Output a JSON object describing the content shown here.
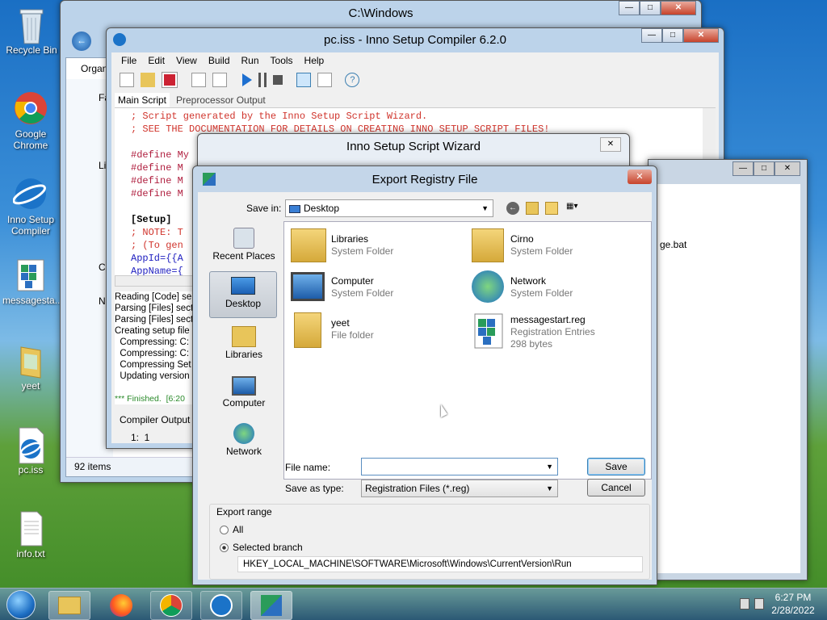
{
  "desktop": {
    "icons": [
      {
        "label": "Recycle Bin",
        "icon": "recycle-bin-icon"
      },
      {
        "label": "Google Chrome",
        "icon": "chrome-icon"
      },
      {
        "label": "Inno Setup Compiler",
        "icon": "inno-setup-icon"
      },
      {
        "label": "messagesta...",
        "icon": "registry-file-icon"
      },
      {
        "label": "yeet",
        "icon": "folder-icon"
      },
      {
        "label": "pc.iss",
        "icon": "inno-script-icon"
      },
      {
        "label": "info.txt",
        "icon": "text-file-icon"
      }
    ]
  },
  "explorer": {
    "title": "C:\\Windows",
    "organize": "Organ",
    "sidebar": [
      "Fa",
      "Li",
      "C",
      "N"
    ],
    "status": "92 items"
  },
  "inno": {
    "title": "pc.iss - Inno Setup Compiler 6.2.0",
    "menu": [
      "File",
      "Edit",
      "View",
      "Build",
      "Run",
      "Tools",
      "Help"
    ],
    "tabs": [
      "Main Script",
      "Preprocessor Output"
    ],
    "code": [
      {
        "t": "; Script generated by the Inno Setup Script Wizard.",
        "c": "cmt"
      },
      {
        "t": "; SEE THE DOCUMENTATION FOR DETAILS ON CREATING INNO SETUP SCRIPT FILES!",
        "c": "cmt"
      },
      {
        "t": "",
        "c": ""
      },
      {
        "t": "#define My",
        "c": "def"
      },
      {
        "t": "#define M",
        "c": "def"
      },
      {
        "t": "#define M",
        "c": "def"
      },
      {
        "t": "#define M",
        "c": "def"
      },
      {
        "t": "",
        "c": ""
      },
      {
        "t": "[Setup]",
        "c": "kw"
      },
      {
        "t": "; NOTE: T",
        "c": "cmt"
      },
      {
        "t": "; (To gen",
        "c": "cmt"
      },
      {
        "t": "AppId={{A",
        "c": "var"
      },
      {
        "t": "AppName={",
        "c": "var"
      }
    ],
    "output": [
      "Reading [Code] se",
      "Parsing [Files] sect",
      "Parsing [Files] sect",
      "Creating setup file",
      "  Compressing: C:",
      "  Compressing: C:",
      "  Compressing Set",
      "  Updating version"
    ],
    "finished": "*** Finished.  [6:20",
    "output_tab": "Compiler Output",
    "position": "1:  1"
  },
  "wizard": {
    "title": "Inno Setup Script Wizard"
  },
  "regedit_bg": {
    "file": "ge.bat"
  },
  "dialog": {
    "title": "Export Registry File",
    "save_in_label": "Save in:",
    "save_in_value": "Desktop",
    "places": [
      {
        "label": "Recent Places",
        "icon": "recent-places-icon"
      },
      {
        "label": "Desktop",
        "icon": "desktop-icon"
      },
      {
        "label": "Libraries",
        "icon": "libraries-icon"
      },
      {
        "label": "Computer",
        "icon": "computer-icon"
      },
      {
        "label": "Network",
        "icon": "network-icon"
      }
    ],
    "items": [
      {
        "name": "Libraries",
        "sub": "System Folder",
        "sub2": "",
        "icon": "libraries-icon"
      },
      {
        "name": "Cirno",
        "sub": "System Folder",
        "sub2": "",
        "icon": "user-folder-icon"
      },
      {
        "name": "Computer",
        "sub": "System Folder",
        "sub2": "",
        "icon": "computer-icon"
      },
      {
        "name": "Network",
        "sub": "System Folder",
        "sub2": "",
        "icon": "network-icon"
      },
      {
        "name": "yeet",
        "sub": "File folder",
        "sub2": "",
        "icon": "folder-icon"
      },
      {
        "name": "messagestart.reg",
        "sub": "Registration Entries",
        "sub2": "298 bytes",
        "icon": "registry-file-icon"
      }
    ],
    "file_name_label": "File name:",
    "file_name_value": "",
    "save_as_label": "Save as type:",
    "save_as_value": "Registration Files (*.reg)",
    "save": "Save",
    "cancel": "Cancel",
    "export_range": "Export range",
    "all": "All",
    "selected_branch": "Selected branch",
    "branch_path": "HKEY_LOCAL_MACHINE\\SOFTWARE\\Microsoft\\Windows\\CurrentVersion\\Run"
  },
  "taskbar": {
    "time": "6:27 PM",
    "date": "2/28/2022"
  }
}
